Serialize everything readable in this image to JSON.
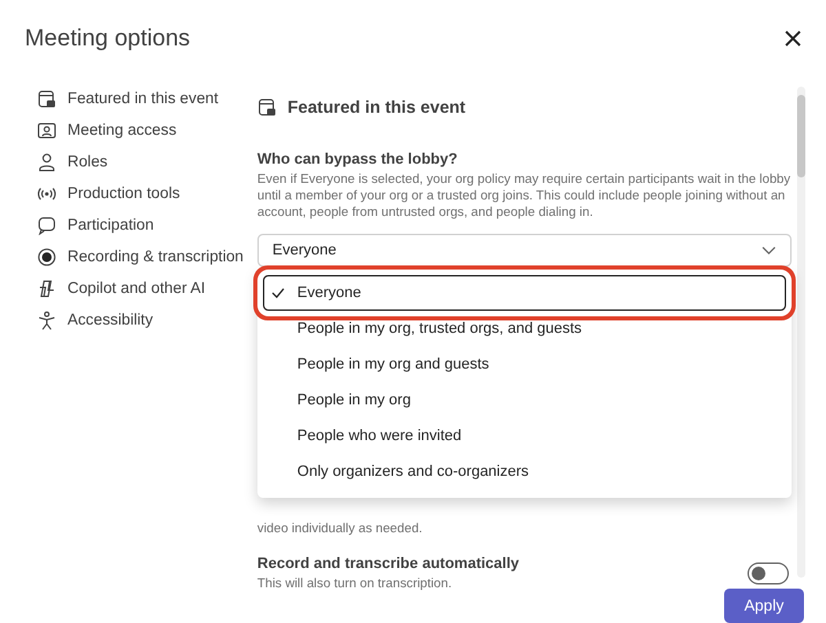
{
  "window": {
    "title": "Meeting options"
  },
  "sidebar": {
    "items": [
      {
        "label": "Featured in this event",
        "kind": "featured"
      },
      {
        "label": "Meeting access",
        "kind": "access"
      },
      {
        "label": "Roles",
        "kind": "roles"
      },
      {
        "label": "Production tools",
        "kind": "production"
      },
      {
        "label": "Participation",
        "kind": "participation"
      },
      {
        "label": "Recording & transcription",
        "kind": "recording"
      },
      {
        "label": "Copilot and other AI",
        "kind": "copilot"
      },
      {
        "label": "Accessibility",
        "kind": "accessibility"
      }
    ]
  },
  "section": {
    "heading": "Featured in this event",
    "lobby": {
      "label": "Who can bypass the lobby?",
      "description": "Even if Everyone is selected, your org policy may require certain participants wait in the lobby until a member of your org or a trusted org joins. This could include people joining without an account, people from untrusted orgs, and people dialing in.",
      "value": "Everyone",
      "options": [
        {
          "label": "Everyone",
          "selected": true
        },
        {
          "label": "People in my org, trusted orgs, and guests",
          "selected": false
        },
        {
          "label": "People in my org and guests",
          "selected": false
        },
        {
          "label": "People in my org",
          "selected": false
        },
        {
          "label": "People who were invited",
          "selected": false
        },
        {
          "label": "Only organizers and co-organizers",
          "selected": false
        }
      ]
    },
    "video_note": "video individually as needed.",
    "record": {
      "label": "Record and transcribe automatically",
      "description": "This will also turn on transcription.",
      "on": false
    }
  },
  "buttons": [
    "Apply"
  ]
}
